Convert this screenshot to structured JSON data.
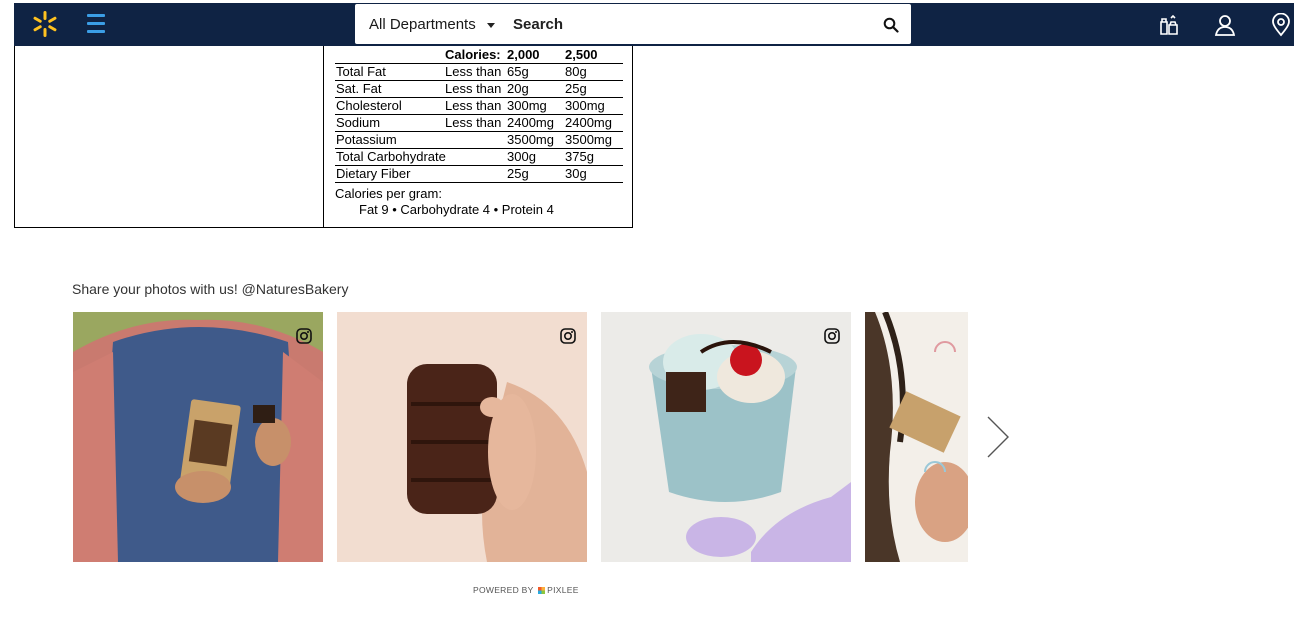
{
  "header": {
    "departments_label": "All Departments",
    "search_placeholder": "Search",
    "colors": {
      "bar": "#0f2344",
      "spark": "#ffc220",
      "menu": "#3b9ee6"
    },
    "icons": [
      "walmart-spark-icon",
      "menu-icon",
      "search-icon",
      "reorder-icon",
      "account-icon",
      "location-icon"
    ]
  },
  "nutrition": {
    "head": {
      "c1": "",
      "c2": "Calories:",
      "c3": "2,000",
      "c4": "2,500"
    },
    "rows": [
      {
        "c1": "Total Fat",
        "c2": "Less than",
        "c3": "65g",
        "c4": "80g"
      },
      {
        "c1": "Sat. Fat",
        "c2": "Less than",
        "c3": "20g",
        "c4": "25g"
      },
      {
        "c1": "Cholesterol",
        "c2": "Less than",
        "c3": "300mg",
        "c4": "300mg"
      },
      {
        "c1": "Sodium",
        "c2": "Less than",
        "c3": "2400mg",
        "c4": "2400mg"
      },
      {
        "c1": "Potassium",
        "c2": "",
        "c3": "3500mg",
        "c4": "3500mg"
      },
      {
        "c1": "Total Carbohydrate",
        "c2": "",
        "c3": "300g",
        "c4": "375g"
      },
      {
        "c1": "Dietary Fiber",
        "c2": "",
        "c3": "25g",
        "c4": "30g"
      }
    ],
    "calories_per_gram_label": "Calories per gram:",
    "calories_per_gram_values": "Fat 9 • Carbohydrate 4 • Protein 4"
  },
  "share": {
    "title": "Share your photos with us! @NaturesBakery",
    "photos": [
      {
        "icon": "instagram-icon"
      },
      {
        "icon": "instagram-icon"
      },
      {
        "icon": "instagram-icon"
      },
      {
        "icon": ""
      }
    ],
    "next_icon": "chevron-right-icon",
    "powered_prefix": "POWERED BY",
    "powered_brand": "PIXLEE"
  }
}
